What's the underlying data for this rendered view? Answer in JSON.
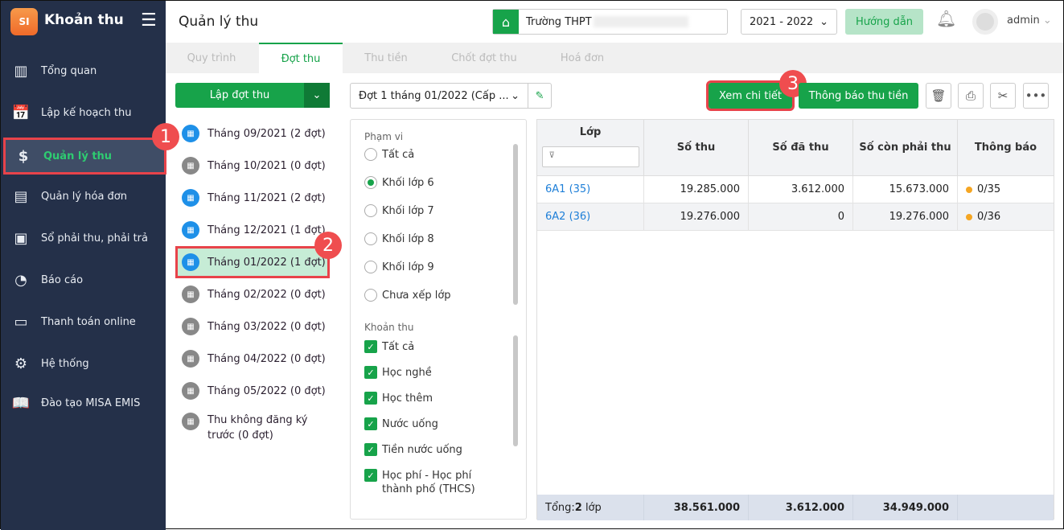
{
  "app": {
    "title": "Khoản thu",
    "logo_text": "SI"
  },
  "sidebar": {
    "items": [
      {
        "label": "Tổng quan",
        "icon": "bar-chart-icon"
      },
      {
        "label": "Lập kế hoạch thu",
        "icon": "calendar-money-icon"
      },
      {
        "label": "Quản lý thu",
        "icon": "hand-money-icon",
        "active": true
      },
      {
        "label": "Quản lý hóa đơn",
        "icon": "document-icon"
      },
      {
        "label": "Sổ phải thu, phải trả",
        "icon": "ledger-icon"
      },
      {
        "label": "Báo cáo",
        "icon": "pie-chart-icon"
      },
      {
        "label": "Thanh toán online",
        "icon": "card-icon"
      },
      {
        "label": "Hệ thống",
        "icon": "gear-icon"
      },
      {
        "label": "Đào tạo MISA EMIS",
        "icon": "book-icon"
      }
    ]
  },
  "header": {
    "title": "Quản lý thu",
    "school": "Trường THPT",
    "year": "2021 - 2022",
    "guide": "Hướng dẫn",
    "user": "admin"
  },
  "tabs": [
    "Quy trình",
    "Đợt thu",
    "Thu tiền",
    "Chốt đợt thu",
    "Hoá đơn"
  ],
  "create_button": "Lập đợt thu",
  "months": [
    "Tháng 09/2021 (2 đợt)",
    "Tháng 10/2021 (0 đợt)",
    "Tháng 11/2021 (2 đợt)",
    "Tháng 12/2021 (1 đợt)",
    "Tháng 01/2022 (1 đợt)",
    "Tháng 02/2022 (0 đợt)",
    "Tháng 03/2022 (0 đợt)",
    "Tháng 04/2022 (0 đợt)",
    "Tháng 05/2022 (0 đợt)",
    "Thu không đăng ký trước (0 đợt)"
  ],
  "batch_select": "Đợt 1 tháng 01/2022 (Cấp ...",
  "toolbar": {
    "detail": "Xem chi tiết",
    "notify": "Thông báo thu tiền"
  },
  "annotations": [
    "1",
    "2",
    "3"
  ],
  "filter": {
    "scope_label": "Phạm vi",
    "scope": [
      "Tất cả",
      "Khối lớp 6",
      "Khối lớp 7",
      "Khối lớp 8",
      "Khối lớp 9",
      "Chưa xếp lớp"
    ],
    "fees_label": "Khoản thu",
    "fees": [
      "Tất cả",
      "Học nghề",
      "Học thêm",
      "Nước uống",
      "Tiền nước uống",
      "Học phí - Học phí thành phố (THCS)"
    ]
  },
  "table": {
    "headers": [
      "Lớp",
      "Số thu",
      "Số đã thu",
      "Số còn phải thu",
      "Thông báo"
    ],
    "rows": [
      [
        "6A1 (35)",
        "19.285.000",
        "3.612.000",
        "15.673.000",
        "0/35"
      ],
      [
        "6A2 (36)",
        "19.276.000",
        "0",
        "19.276.000",
        "0/36"
      ]
    ],
    "footer": {
      "label": "Tổng: ",
      "count": "2",
      "unit": " lớp",
      "total": "38.561.000",
      "paid": "3.612.000",
      "remaining": "34.949.000"
    }
  },
  "colors": {
    "sidebar": "#243049",
    "accent": "#17a34a",
    "annotation": "#ef4d4f"
  }
}
